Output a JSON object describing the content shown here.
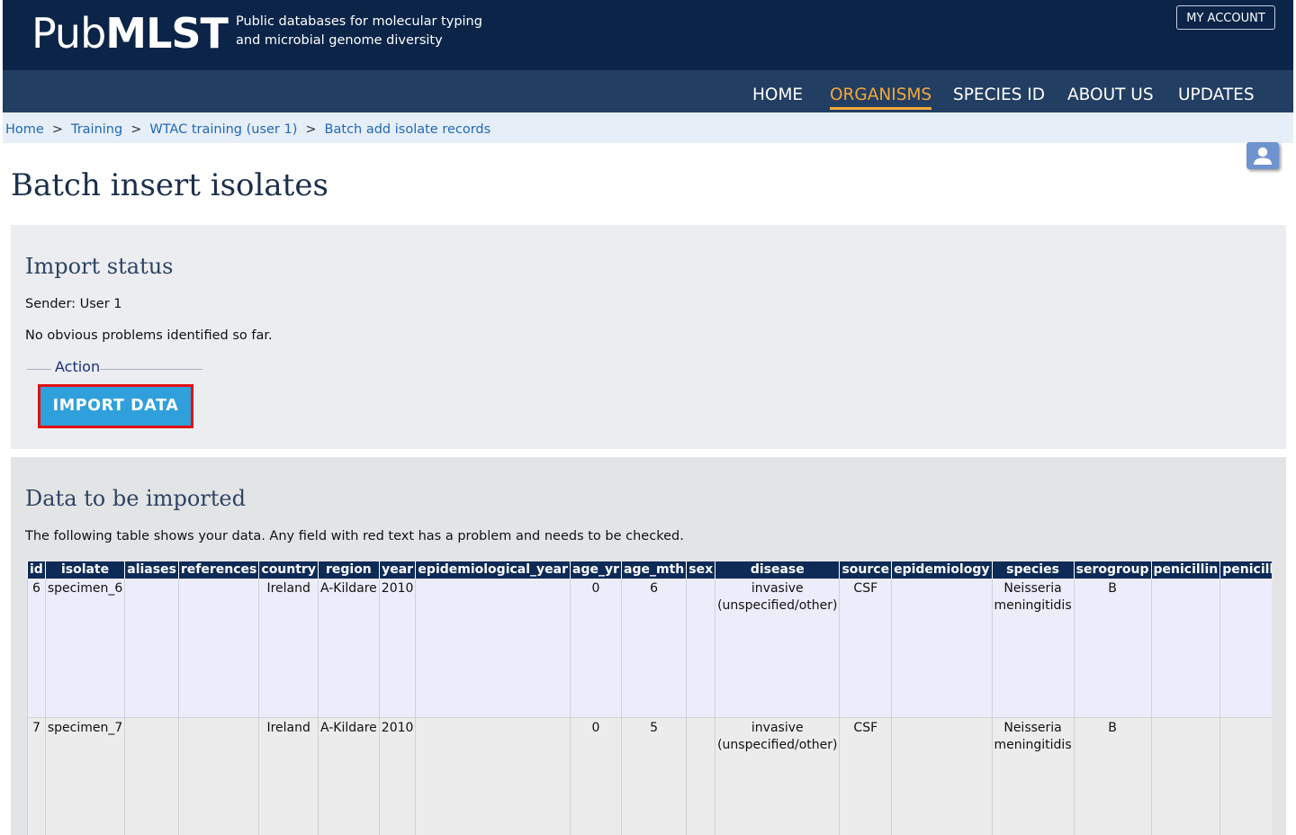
{
  "header": {
    "logo_light": "Pub",
    "logo_bold": "MLST",
    "tagline_line1": "Public databases for molecular typing",
    "tagline_line2": "and microbial genome diversity",
    "account_label": "MY ACCOUNT"
  },
  "nav": {
    "items": [
      "HOME",
      "ORGANISMS",
      "SPECIES ID",
      "ABOUT US",
      "UPDATES"
    ],
    "active": "ORGANISMS",
    "accent_color": "#f2a93b"
  },
  "breadcrumb": [
    "Home",
    "Training",
    "WTAC training (user 1)",
    "Batch add isolate records"
  ],
  "breadcrumb_separator": ">",
  "page_title": "Batch insert isolates",
  "status_panel": {
    "heading": "Import status",
    "sender": "Sender: User 1",
    "message": "No obvious problems identified so far.",
    "action_legend": "Action",
    "import_button": "IMPORT DATA"
  },
  "data_panel": {
    "heading": "Data to be imported",
    "description": "The following table shows your data. Any field with red text has a problem and needs to be checked.",
    "columns": [
      "id",
      "isolate",
      "aliases",
      "references",
      "country",
      "region",
      "year",
      "epidemiological_year",
      "age_yr",
      "age_mth",
      "sex",
      "disease",
      "source",
      "epidemiology",
      "species",
      "serogroup",
      "penicillin",
      "penicillin_range"
    ],
    "rows": [
      [
        "6",
        "specimen_6",
        "",
        "",
        "Ireland",
        "A-Kildare",
        "2010",
        "",
        "0",
        "6",
        "",
        "invasive (unspecified/other)",
        "CSF",
        "",
        "Neisseria meningitidis",
        "B",
        "",
        ""
      ],
      [
        "7",
        "specimen_7",
        "",
        "",
        "Ireland",
        "A-Kildare",
        "2010",
        "",
        "0",
        "5",
        "",
        "invasive (unspecified/other)",
        "CSF",
        "",
        "Neisseria meningitidis",
        "B",
        "",
        ""
      ]
    ]
  },
  "colors": {
    "header_bg": "#0b2448",
    "nav_bg": "#223e62",
    "button_bg": "#2fa0db",
    "button_highlight_border": "#e21010"
  },
  "icons": [
    "user-icon"
  ]
}
